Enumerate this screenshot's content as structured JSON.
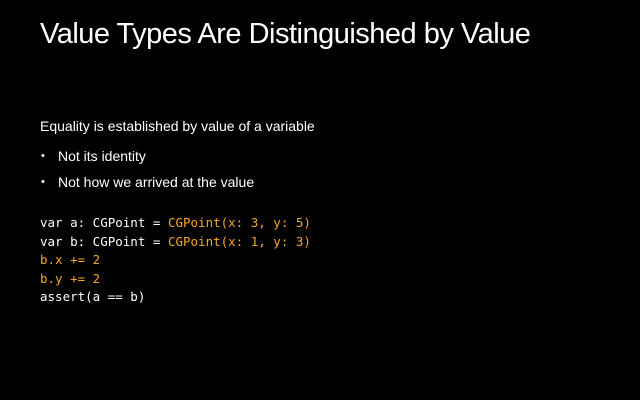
{
  "slide": {
    "title": "Value Types Are Distinguished by Value",
    "lead": "Equality is established by value of a variable",
    "bullets": [
      "Not its identity",
      "Not how we arrived at the value"
    ],
    "bullet_glyph": "•",
    "code": {
      "line1_plain": "var a: CGPoint = ",
      "line1_hl": "CGPoint(x: 3, y: 5)",
      "line2_plain": "var b: CGPoint = ",
      "line2_hl": "CGPoint(x: 1, y: 3)",
      "line3_hl": "b.x += 2",
      "line4_hl": "b.y += 2",
      "line5_plain": "assert(a == b)"
    },
    "colors": {
      "background": "#000000",
      "text": "#ffffff",
      "highlight": "#f5a623"
    }
  }
}
